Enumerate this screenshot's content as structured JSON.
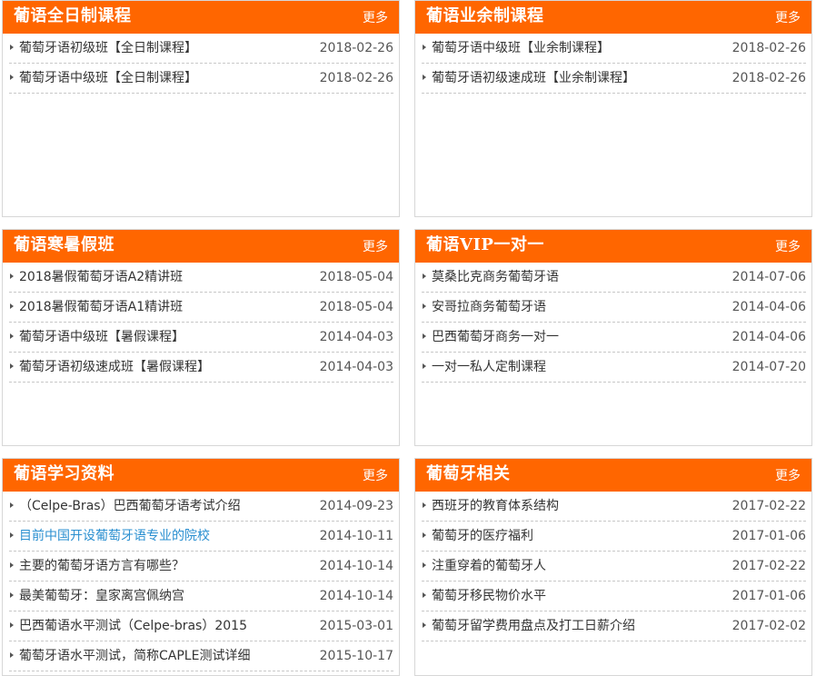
{
  "colors": {
    "accent": "#ff6600",
    "link_highlight": "#2a8fd0",
    "text": "#333333"
  },
  "icons": {
    "bullet": "triangle-right-icon"
  },
  "panels": [
    {
      "title": "葡语全日制课程",
      "more": "更多",
      "items": [
        {
          "title": "葡萄牙语初级班【全日制课程】",
          "date": "2018-02-26"
        },
        {
          "title": "葡萄牙语中级班【全日制课程】",
          "date": "2018-02-26"
        }
      ]
    },
    {
      "title": "葡语业余制课程",
      "more": "更多",
      "items": [
        {
          "title": "葡萄牙语中级班【业余制课程】",
          "date": "2018-02-26"
        },
        {
          "title": "葡萄牙语初级速成班【业余制课程】",
          "date": "2018-02-26"
        }
      ]
    },
    {
      "title": "葡语寒暑假班",
      "more": "更多",
      "items": [
        {
          "title": "2018暑假葡萄牙语A2精讲班",
          "date": "2018-05-04"
        },
        {
          "title": "2018暑假葡萄牙语A1精讲班",
          "date": "2018-05-04"
        },
        {
          "title": "葡萄牙语中级班【暑假课程】",
          "date": "2014-04-03"
        },
        {
          "title": "葡萄牙语初级速成班【暑假课程】",
          "date": "2014-04-03"
        }
      ]
    },
    {
      "title": "葡语VIP一对一",
      "more": "更多",
      "items": [
        {
          "title": "莫桑比克商务葡萄牙语",
          "date": "2014-07-06"
        },
        {
          "title": "安哥拉商务葡萄牙语",
          "date": "2014-04-06"
        },
        {
          "title": "巴西葡萄牙商务一对一",
          "date": "2014-04-06"
        },
        {
          "title": "一对一私人定制课程",
          "date": "2014-07-20"
        }
      ]
    },
    {
      "title": "葡语学习资料",
      "more": "更多",
      "items": [
        {
          "title": "（Celpe-Bras）巴西葡萄牙语考试介绍",
          "date": "2014-09-23"
        },
        {
          "title": "目前中国开设葡萄牙语专业的院校",
          "date": "2014-10-11"
        },
        {
          "title": "主要的葡萄牙语方言有哪些？",
          "date": "2014-10-14"
        },
        {
          "title": "最美葡萄牙：皇家离宫佩纳宫",
          "date": "2014-10-14"
        },
        {
          "title": "巴西葡语水平测试（Celpe-bras）2015",
          "date": "2015-03-01"
        },
        {
          "title": "葡萄牙语水平测试，简称CAPLE测试详细",
          "date": "2015-10-17"
        }
      ]
    },
    {
      "title": "葡萄牙相关",
      "more": "更多",
      "items": [
        {
          "title": "西班牙的教育体系结构",
          "date": "2017-02-22"
        },
        {
          "title": "葡萄牙的医疗福利",
          "date": "2017-01-06"
        },
        {
          "title": "注重穿着的葡萄牙人",
          "date": "2017-02-22"
        },
        {
          "title": "葡萄牙移民物价水平",
          "date": "2017-01-06"
        },
        {
          "title": "葡萄牙留学费用盘点及打工日薪介绍",
          "date": "2017-02-02"
        }
      ]
    }
  ]
}
